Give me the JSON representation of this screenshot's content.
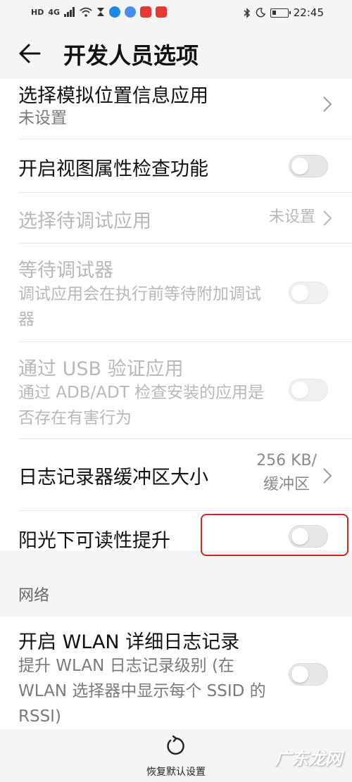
{
  "status_bar": {
    "left_badges": [
      "HD",
      "4G"
    ],
    "time": "22:45",
    "icons": [
      "signal-icon",
      "wifi-icon",
      "hourglass-icon",
      "app-icon",
      "music-icon",
      "tmall-icon",
      "message-icon",
      "bluetooth-icon",
      "moon-icon",
      "battery-icon"
    ]
  },
  "header": {
    "title": "开发人员选项"
  },
  "settings": [
    {
      "title": "选择模拟位置信息应用",
      "subtitle": "未设置",
      "control": "chevron",
      "enabled": true
    },
    {
      "title": "开启视图属性检查功能",
      "control": "toggle",
      "on": false,
      "enabled": true
    },
    {
      "title": "选择待调试应用",
      "value": "未设置",
      "control": "chevron",
      "enabled": false
    },
    {
      "title": "等待调试器",
      "subtitle": "调试应用会在执行前等待附加调试器",
      "control": "toggle",
      "on": false,
      "enabled": false
    },
    {
      "title": "通过 USB 验证应用",
      "subtitle": "通过 ADB/ADT 检查安装的应用是否存在有害行为",
      "control": "toggle",
      "on": false,
      "enabled": false
    },
    {
      "title": "日志记录器缓冲区大小",
      "value_line1": "256 KB/",
      "value_line2": "缓冲区",
      "control": "chevron",
      "enabled": true
    },
    {
      "title": "阳光下可读性提升",
      "control": "toggle",
      "on": false,
      "enabled": true
    }
  ],
  "network": {
    "section_label": "网络",
    "wlan_title": "开启 WLAN 详细日志记录",
    "wlan_subtitle": "提升 WLAN 日志记录级别 (在 WLAN 选择器中显示每个 SSID 的 RSSI)",
    "wlan_on": false
  },
  "footer": {
    "restore_label": "恢复默认设置"
  },
  "watermark": "广东龙网",
  "colors": {
    "highlight_box": "#c62828",
    "toggle_off": "#e8e8e8",
    "disabled_text": "#b8b8b8"
  }
}
